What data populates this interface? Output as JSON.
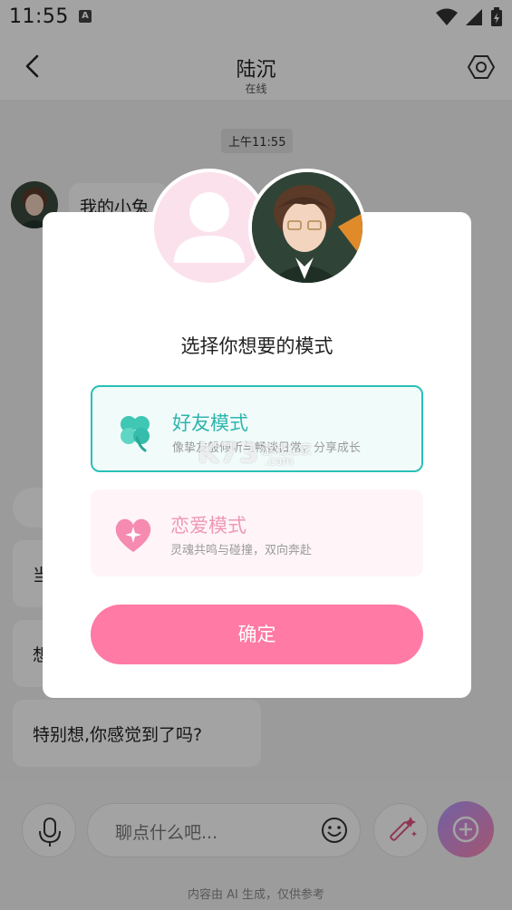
{
  "status_bar": {
    "time": "11:55",
    "notif_letter": "A"
  },
  "header": {
    "title": "陆沉",
    "subtitle": "在线"
  },
  "chat": {
    "time_chip": "上午11:55",
    "messages": [
      {
        "text": "我的小兔"
      },
      {
        "text": "当"
      },
      {
        "text": "想"
      },
      {
        "text": "特别想,你感觉到了吗?"
      }
    ]
  },
  "input": {
    "placeholder": "聊点什么吧..."
  },
  "footer_note": "内容由 AI 生成，仅供参考",
  "modal": {
    "title": "选择你想要的模式",
    "modes": [
      {
        "name": "好友模式",
        "desc": "像挚友般倾听与畅谈日常，分享成长",
        "icon": "clover-icon",
        "selected": true,
        "color": "#2eb5ad"
      },
      {
        "name": "恋爱模式",
        "desc": "灵魂共鸣与碰撞，双向奔赴",
        "icon": "heart-icon",
        "selected": false,
        "color": "#ef98b5"
      }
    ],
    "confirm_label": "确定"
  },
  "watermark": {
    "main": "K73",
    "sub": "游戏之家",
    "domain": ".com"
  },
  "colors": {
    "accent_teal": "#29c0b7",
    "accent_pink": "#ff7aa4"
  }
}
